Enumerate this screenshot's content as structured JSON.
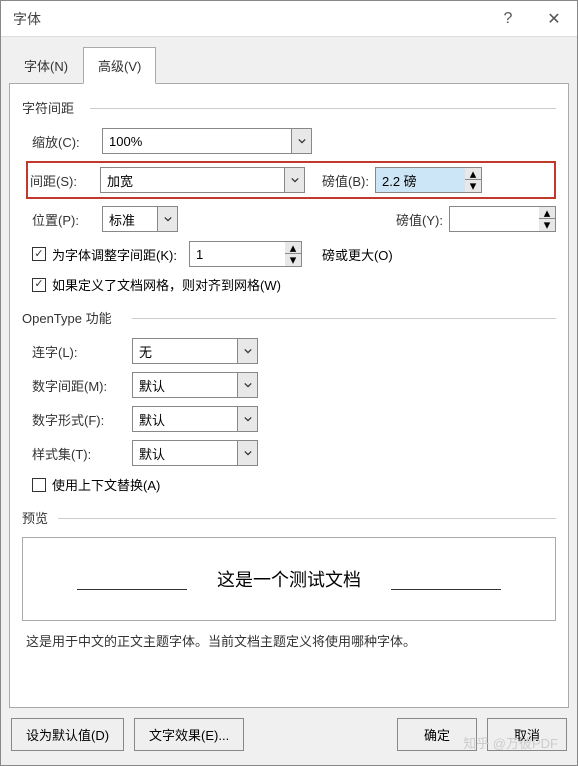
{
  "title": "字体",
  "tabs": {
    "font": "字体(N)",
    "advanced": "高级(V)"
  },
  "charSpacing": {
    "legend": "字符间距",
    "scale": {
      "label": "缩放(C):",
      "value": "100%"
    },
    "spacing": {
      "label": "间距(S):",
      "value": "加宽",
      "byLabel": "磅值(B):",
      "byValue": "2.2 磅"
    },
    "position": {
      "label": "位置(P):",
      "value": "标准",
      "byLabel": "磅值(Y):",
      "byValue": ""
    },
    "kerning": {
      "label": "为字体调整字间距(K):",
      "value": "1",
      "suffix": "磅或更大(O)"
    },
    "snap": "如果定义了文档网格，则对齐到网格(W)"
  },
  "opentype": {
    "legend": "OpenType 功能",
    "ligatures": {
      "label": "连字(L):",
      "value": "无"
    },
    "numSpacing": {
      "label": "数字间距(M):",
      "value": "默认"
    },
    "numForms": {
      "label": "数字形式(F):",
      "value": "默认"
    },
    "stylistic": {
      "label": "样式集(T):",
      "value": "默认"
    },
    "contextual": "使用上下文替换(A)"
  },
  "preview": {
    "legend": "预览",
    "sample": "这是一个测试文档",
    "desc": "这是用于中文的正文主题字体。当前文档主题定义将使用哪种字体。"
  },
  "footer": {
    "default": "设为默认值(D)",
    "effects": "文字效果(E)...",
    "ok": "确定",
    "cancel": "取消"
  },
  "watermark": "知乎 @万彼PDF"
}
